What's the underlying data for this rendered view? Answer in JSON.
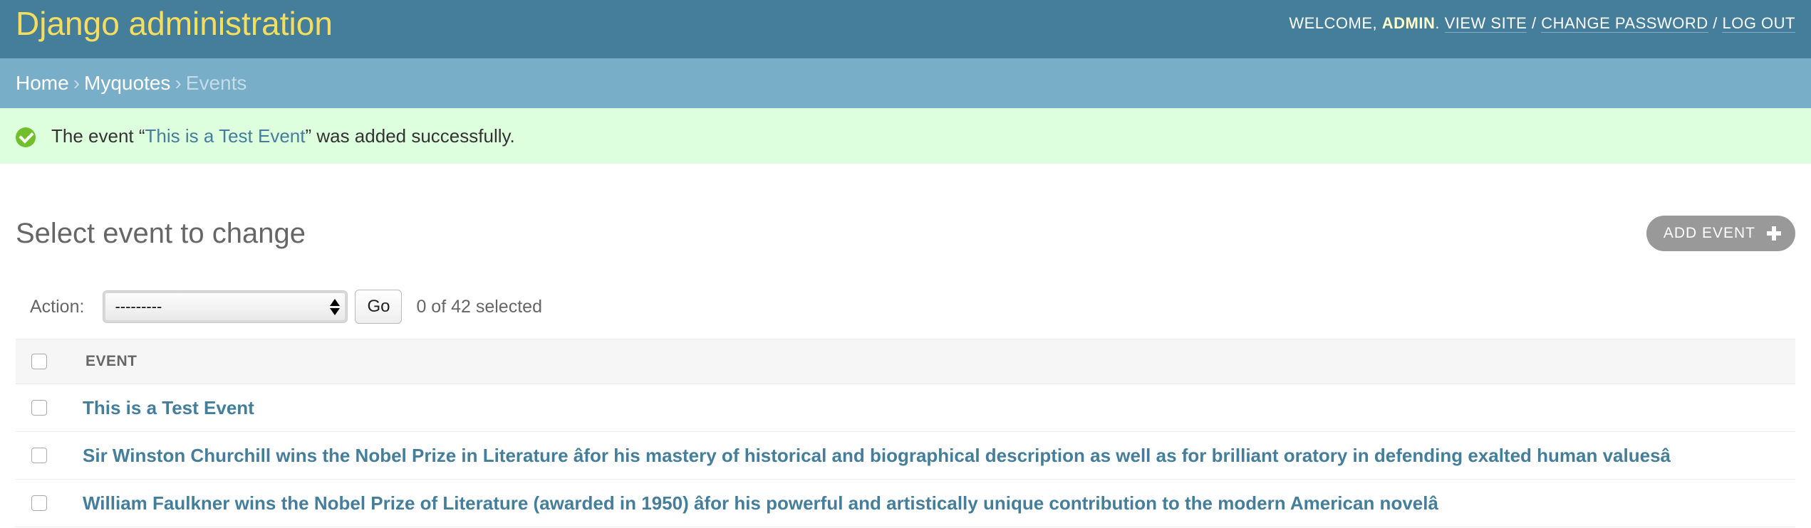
{
  "header": {
    "branding": "Django administration",
    "welcome": "Welcome,",
    "username": "admin",
    "view_site": "View site",
    "change_password": "Change password",
    "log_out": "Log out"
  },
  "breadcrumbs": {
    "home": "Home",
    "app": "Myquotes",
    "current": "Events",
    "separator": "›"
  },
  "message": {
    "prefix": "The event “",
    "link": "This is a Test Event",
    "suffix": "” was added successfully."
  },
  "content": {
    "title": "Select event to change",
    "add_button": "Add event"
  },
  "actions": {
    "label": "Action:",
    "selected_option": "---------",
    "go": "Go",
    "counter": "0 of 42 selected"
  },
  "table": {
    "column_header": "Event",
    "rows": [
      "This is a Test Event",
      "Sir Winston Churchill wins the Nobel Prize in Literature âfor his mastery of historical and biographical description as well as for brilliant oratory in defending exalted human valuesâ",
      "William Faulkner wins the Nobel Prize of Literature (awarded in 1950) âfor his powerful and artistically unique contribution to the modern American novelâ"
    ]
  },
  "colors": {
    "header_bg": "#447e9b",
    "branding": "#f5dd5d",
    "breadcrumbs_bg": "#79aec8",
    "success_bg": "#ddffdd",
    "link": "#447e9b"
  }
}
